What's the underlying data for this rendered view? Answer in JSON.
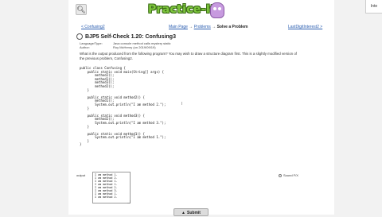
{
  "corner_tab": "Inte",
  "logo": {
    "text": "Practice-It!"
  },
  "nav": {
    "prev": "< Confusing2",
    "crumbs": [
      "Main Page",
      "Problems"
    ],
    "sep": "→",
    "current": "Solve a Problem",
    "next": "LastDigitInterest2 >"
  },
  "problem": {
    "title": "BJP5 Self-Check 1.20: Confusing3",
    "language_key": "Language/Type:",
    "language_val": "Java console method calls mystery static",
    "author_key": "Author:",
    "author_val": "Roy McHenry (on 2019/09/19)",
    "description_1": "What is the output produced from the following program? You may wish to draw a structure diagram first. This is a slightly modified version of",
    "description_2": "the previous problem, Confusing2."
  },
  "code_lines": [
    "public class Confusing {",
    "    public static void main(String[] args) {",
    "        method2();",
    "        method1();",
    "        method3();",
    "        method2();",
    "    }",
    "",
    "    public static void method2() {",
    "        method1();",
    "        System.out.println(\"I am method 2.\");",
    "    }",
    "",
    "    public static void method3() {",
    "        method2();",
    "        System.out.println(\"I am method 3.\");",
    "    }",
    "",
    "    public static void method1() {",
    "        System.out.println(\"I am method 1.\");",
    "    }",
    "}"
  ],
  "answer": {
    "label": "output",
    "value": "I am method 1.\nI am method 2.\nI am method 1.\nI am method 1.\nI am method 2.\nI am method 3.\nI am method 1.\nI am method 2."
  },
  "sound": {
    "label": "Sound F/X"
  },
  "submit": {
    "arrow": "▲",
    "label": "Submit"
  }
}
